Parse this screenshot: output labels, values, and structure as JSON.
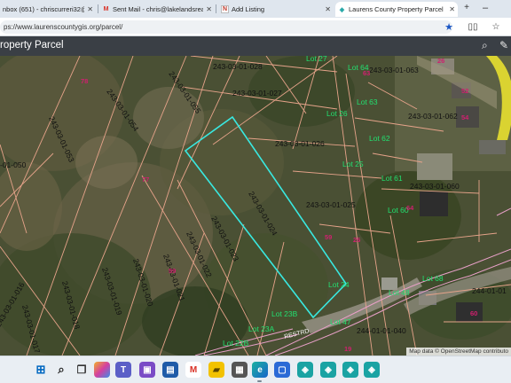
{
  "browser": {
    "tabs": [
      {
        "label": "nbox (651) - chriscurreri32@gma",
        "icon": "gmail-icon",
        "active": false
      },
      {
        "label": "Sent Mail - chris@lakelandsrealty",
        "icon": "gmail-icon",
        "active": false
      },
      {
        "label": "Add Listing",
        "icon": "listing-site-icon",
        "active": false
      },
      {
        "label": "Laurens County Property Parcel",
        "icon": "gis-app-icon",
        "active": true
      }
    ],
    "url": "ps://www.laurenscountygis.org/parcel/"
  },
  "app": {
    "title": "roperty Parcel"
  },
  "map": {
    "parcel_labels": [
      "243-03-01-028",
      "243-03-01-027",
      "243-03-01-055",
      "243-03-01-054",
      "243-03-01-053",
      "243-03-01-026",
      "243-03-01-025",
      "243-03-01-024",
      "243-03-01-023",
      "243-03-01-022",
      "243-03-01-021",
      "243-03-01-020",
      "243-03-01-019",
      "243-03-01-018",
      "243-03-01-017",
      "243-03-01-016",
      "243-03-01-063",
      "243-03-01-062",
      "243-03-01-060",
      "-01-050",
      "244-01-01",
      "244-01-01-040"
    ],
    "lot_labels": [
      "Lot 27",
      "Lot 64",
      "Lot 63",
      "Lot 26",
      "Lot 62",
      "Lot 25",
      "Lot 61",
      "Lot 60",
      "Lot 24",
      "Lot 48",
      "Lot 68",
      "Lot 23B",
      "Lot 47",
      "Lot 23A",
      "Lot 22B"
    ],
    "address_labels": [
      "78",
      "77",
      "59",
      "26",
      "64",
      "52",
      "60",
      "59",
      "26",
      "63",
      "19",
      "54"
    ],
    "road_label": "RESTRD",
    "attribution": "Map data © OpenStreetMap contributo",
    "colors": {
      "selected_parcel": "#39e8e0",
      "parcel_line": "#e6a38a",
      "lot_label": "#20e070",
      "road_line": "#e8a0c8"
    }
  },
  "taskbar": {
    "icons": [
      "windows-start-icon",
      "search-icon",
      "file-explorer-icon",
      "copilot-icon",
      "teams-icon",
      "chat-icon",
      "photos-icon",
      "gmail-icon",
      "edge-icon",
      "microsoft-store-icon",
      "app-icon-1",
      "app-icon-2",
      "app-icon-3",
      "app-icon-4",
      "app-icon-5"
    ]
  }
}
